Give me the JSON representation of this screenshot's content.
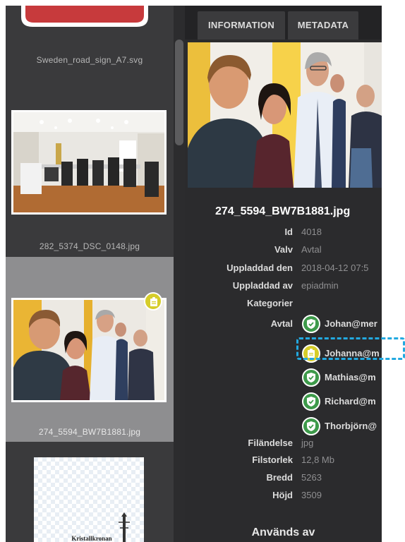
{
  "tabs": {
    "information": "INFORMATION",
    "metadata": "METADATA"
  },
  "thumbnails": [
    {
      "caption": "Sweden_road_sign_A7.svg"
    },
    {
      "caption": "282_5374_DSC_0148.jpg"
    },
    {
      "caption": "274_5594_BW7B1881.jpg",
      "selected": true
    },
    {
      "caption": "",
      "art_text": "Kristallkronan"
    }
  ],
  "details": {
    "filename": "274_5594_BW7B1881.jpg",
    "fields": [
      {
        "label": "Id",
        "value": "4018"
      },
      {
        "label": "Valv",
        "value": "Avtal"
      },
      {
        "label": "Uppladdad den",
        "value": "2018-04-12 07:5"
      },
      {
        "label": "Uppladdad av",
        "value": "epiadmin"
      },
      {
        "label": "Kategorier",
        "value": ""
      },
      {
        "label": "Avtal",
        "value": ""
      }
    ],
    "approvers": [
      {
        "name": "Johan@mer",
        "status": "approved"
      },
      {
        "name": "Johanna@m",
        "status": "pending"
      },
      {
        "name": "Mathias@m",
        "status": "approved"
      },
      {
        "name": "Richard@m",
        "status": "approved"
      },
      {
        "name": "Thorbjörn@",
        "status": "approved"
      }
    ],
    "file_fields": [
      {
        "label": "Filändelse",
        "value": "jpg"
      },
      {
        "label": "Filstorlek",
        "value": "12,8 Mb"
      },
      {
        "label": "Bredd",
        "value": "5263"
      },
      {
        "label": "Höjd",
        "value": "3509"
      }
    ],
    "used_by": "Används av"
  },
  "colors": {
    "approved": "#3d9a4a",
    "pending": "#d6cd2a",
    "highlight": "#22a9e0",
    "panel_dark": "#2b2b2d",
    "panel_left": "#3a3a3c"
  }
}
